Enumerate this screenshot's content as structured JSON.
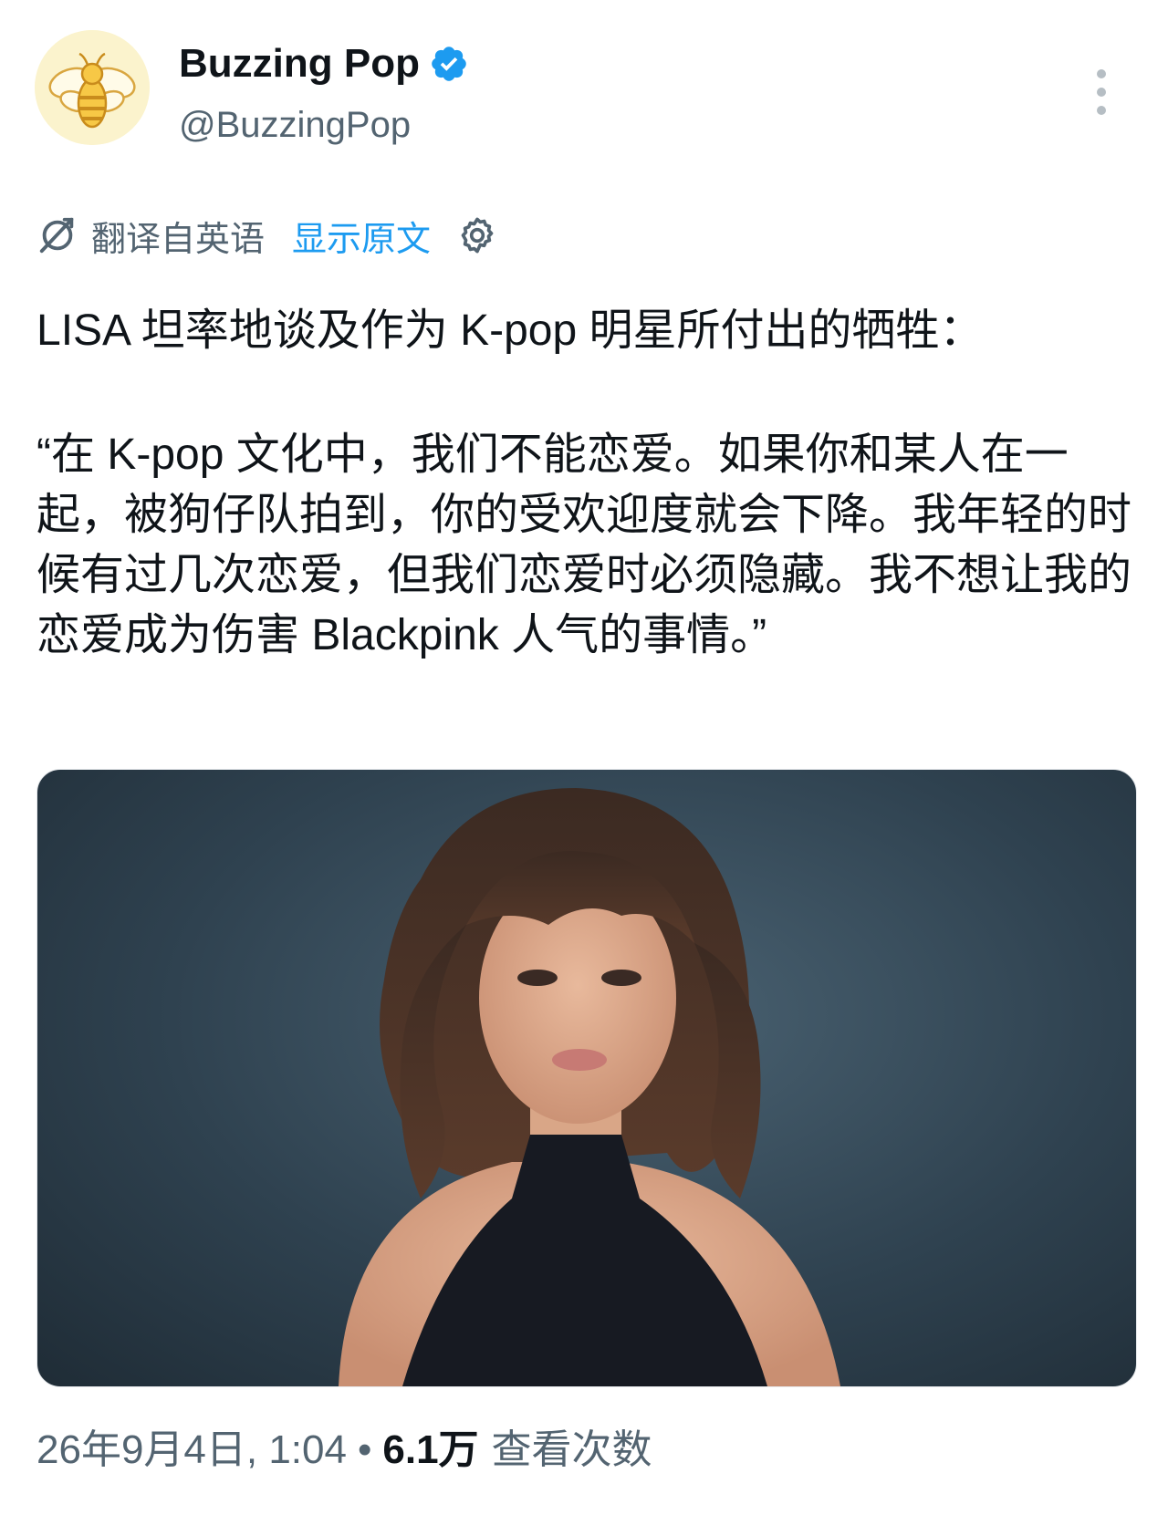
{
  "author": {
    "display_name": "Buzzing Pop",
    "handle": "@BuzzingPop",
    "verified_color": "#1d9bf0",
    "avatar_icon": "bee-icon"
  },
  "translation": {
    "label": "翻译自英语",
    "show_original": "显示原文",
    "icon": "translate-icon",
    "settings_icon": "gear-icon"
  },
  "tweet": {
    "intro": "LISA 坦率地谈及作为 K-pop 明星所付出的牺牲：",
    "quote": "“在 K-pop 文化中，我们不能恋爱。如果你和某人在一起，被狗仔队拍到，你的受欢迎度就会下降。我年轻的时候有过几次恋爱，但我们恋爱时必须隐藏。我不想让我的恋爱成为伤害 Blackpink 人气的事情。”"
  },
  "meta": {
    "timestamp": "26年9月4日, 1:04",
    "separator": "•",
    "views_count": "6.1万",
    "views_label": "查看次数"
  },
  "colors": {
    "accent": "#1d9bf0",
    "secondary_text": "#536471",
    "primary_text": "#0f1419"
  }
}
